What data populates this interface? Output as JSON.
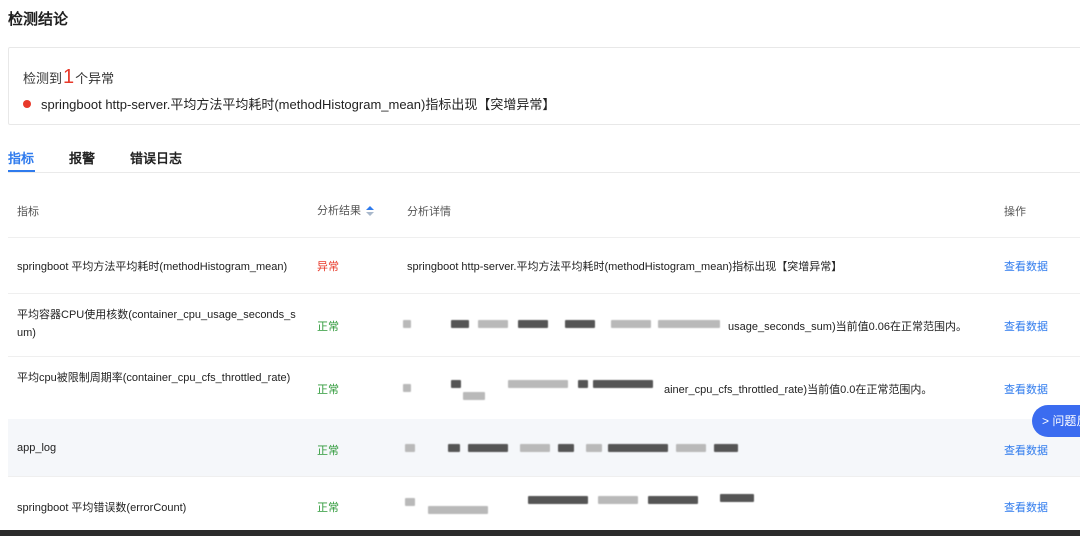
{
  "title": "检测结论",
  "summary": {
    "prefix": "检测到",
    "count": "1",
    "suffix": "个异常",
    "anomaly": "springboot http-server.平均方法平均耗时(methodHistogram_mean)指标出现【突增异常】"
  },
  "tabs": [
    "指标",
    "报警",
    "错误日志"
  ],
  "table": {
    "headers": {
      "metric": "指标",
      "result": "分析结果",
      "detail": "分析详情",
      "action": "操作"
    },
    "rows": [
      {
        "metric": "springboot 平均方法平均耗时(methodHistogram_mean)",
        "result": "异常",
        "detail": "springboot http-server.平均方法平均耗时(methodHistogram_mean)指标出现【突增异常】",
        "action": "查看数据"
      },
      {
        "metric": "平均容器CPU使用核数(container_cpu_usage_seconds_sum)",
        "result": "正常",
        "detail": "usage_seconds_sum)当前值0.06在正常范围内。",
        "action": "查看数据"
      },
      {
        "metric": "平均cpu被限制周期率(container_cpu_cfs_throttled_rate)",
        "result": "正常",
        "detail": "ainer_cpu_cfs_throttled_rate)当前值0.0在正常范围内。",
        "action": "查看数据"
      },
      {
        "metric": "app_log",
        "result": "正常",
        "detail": "",
        "action": "查看数据"
      },
      {
        "metric": "springboot 平均错误数(errorCount)",
        "result": "正常",
        "detail": "",
        "action": "查看数据"
      }
    ]
  },
  "feedback": "> 问题反"
}
